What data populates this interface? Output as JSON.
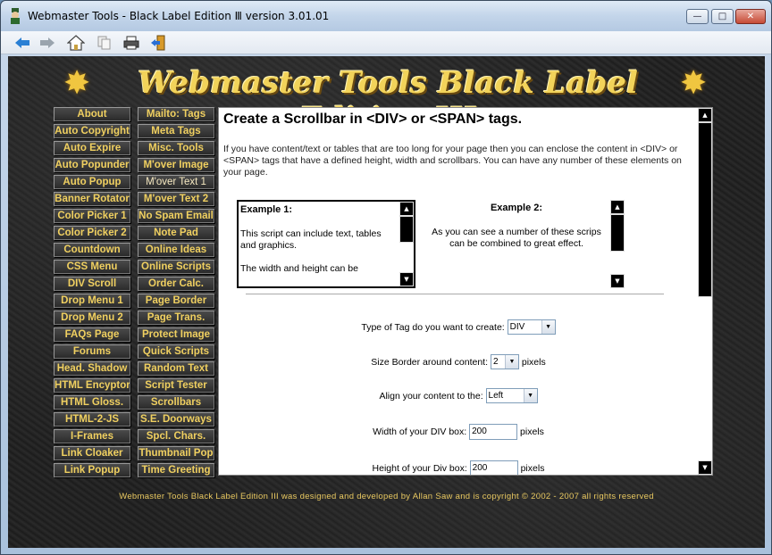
{
  "window": {
    "title": "Webmaster Tools - Black Label Edition Ⅲ version 3.01.01",
    "minimize": "—",
    "maximize": "□",
    "close": "✕"
  },
  "toolbar": {
    "icons": [
      "back-arrow-icon",
      "forward-arrow-icon",
      "home-icon",
      "copy-icon",
      "print-icon",
      "exit-door-icon"
    ]
  },
  "banner": {
    "title": "Webmaster Tools Black Label Edition III",
    "star": "✸"
  },
  "nav_left": [
    "About",
    "Auto Copyright",
    "Auto Expire",
    "Auto Popunder",
    "Auto Popup",
    "Banner Rotator",
    "Color Picker 1",
    "Color Picker 2",
    "Countdown",
    "CSS Menu",
    "DIV Scroll",
    "Drop Menu 1",
    "Drop Menu 2",
    "FAQs Page",
    "Forums",
    "Head. Shadow",
    "HTML Encyptor",
    "HTML Gloss.",
    "HTML-2-JS",
    "I-Frames",
    "Link Cloaker",
    "Link Popup"
  ],
  "nav_right": [
    "Mailto: Tags",
    "Meta Tags",
    "Misc. Tools",
    "M'over Image",
    "M'over Text 1",
    "M'over Text 2",
    "No Spam Email",
    "Note Pad",
    "Online Ideas",
    "Online Scripts",
    "Order Calc.",
    "Page Border",
    "Page Trans.",
    "Protect Image",
    "Quick Scripts",
    "Random Text",
    "Script Tester",
    "Scrollbars",
    "S.E. Doorways",
    "Spcl. Chars.",
    "Thumbnail Pop",
    "Time Greeting"
  ],
  "content": {
    "title": "Create a Scrollbar in <DIV> or <SPAN> tags.",
    "description": "If you have content/text or tables that are too long for your page then you can enclose the content in <DIV> or <SPAN> tags that have a defined height, width and scrollbars. You can have any number of these elements on your page.",
    "example1": {
      "heading": "Example 1:",
      "p1": "This script can include text, tables and graphics.",
      "p2": "The width and height can be"
    },
    "example2": {
      "heading": "Example 2:",
      "p1": "As you can see a number of these scrips can be combined to great effect."
    },
    "form": {
      "tag_label": "Type of Tag do you want to create:",
      "tag_value": "DIV",
      "border_label": "Size Border around content:",
      "border_value": "2",
      "border_unit": "pixels",
      "align_label": "Align your content to the:",
      "align_value": "Left",
      "width_label": "Width of your DIV box:",
      "width_value": "200",
      "width_unit": "pixels",
      "height_label": "Height of your Div box:",
      "height_value": "200",
      "height_unit": "pixels"
    }
  },
  "footer": "Webmaster Tools Black Label Edition III was designed and developed by Allan Saw and is copyright © 2002 - 2007 all rights reserved"
}
